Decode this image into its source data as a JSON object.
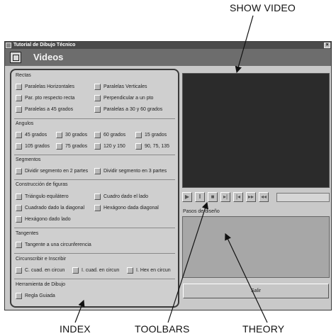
{
  "annotations": {
    "show_video": "SHOW VIDEO",
    "index": "INDEX",
    "toolbars": "TOOLBARS",
    "theory": "THEORY"
  },
  "window": {
    "title": "Tutorial de Dibujo Técnico",
    "close_glyph": "×",
    "header_title": "Videos"
  },
  "sections": {
    "rectas": {
      "title": "Rectas",
      "items": [
        "Paralelas Horizontales",
        "Paralelas Verticales",
        "Par. pto respecto recta",
        "Perpendicular a un pto",
        "Paralelas a 45 grados",
        "Paralelas a 30 y 60 grados"
      ]
    },
    "angulos": {
      "title": "Angulos",
      "items": [
        "45 grados",
        "30 grados",
        "60 grados",
        "15 grados",
        "105 grados",
        "75 grados",
        "120 y 150",
        "90, 75, 135"
      ]
    },
    "segmentos": {
      "title": "Segmentos",
      "items": [
        "Dividir segmento en 2 partes",
        "Dividir segmento en 3 partes"
      ]
    },
    "figuras": {
      "title": "Construcción de figuras",
      "items": [
        "Triángulo equilátero",
        "Cuadro dado el lado",
        "Cuadrado dado la diagonal",
        "Hexágono dada diagonal",
        "Hexágono dado lado"
      ]
    },
    "tangentes": {
      "title": "Tangentes",
      "items": [
        "Tangente a una circunferencia"
      ]
    },
    "circunscribir": {
      "title": "Circunscribir e Inscribir",
      "items": [
        "C. cuad. en circun",
        "I. cuad. en circun",
        "I. Hex en circun"
      ]
    },
    "herramienta": {
      "title": "Herramienta de Dibujo",
      "items": [
        "Regla Guiada"
      ]
    }
  },
  "theory": {
    "label": "Pasos de diseño"
  },
  "exit": {
    "label": "Salir"
  },
  "toolbar": {
    "icons": [
      "play-icon",
      "pause-icon",
      "stop-icon",
      "step-forward-icon",
      "step-back-icon",
      "fast-forward-icon",
      "rewind-icon"
    ]
  }
}
